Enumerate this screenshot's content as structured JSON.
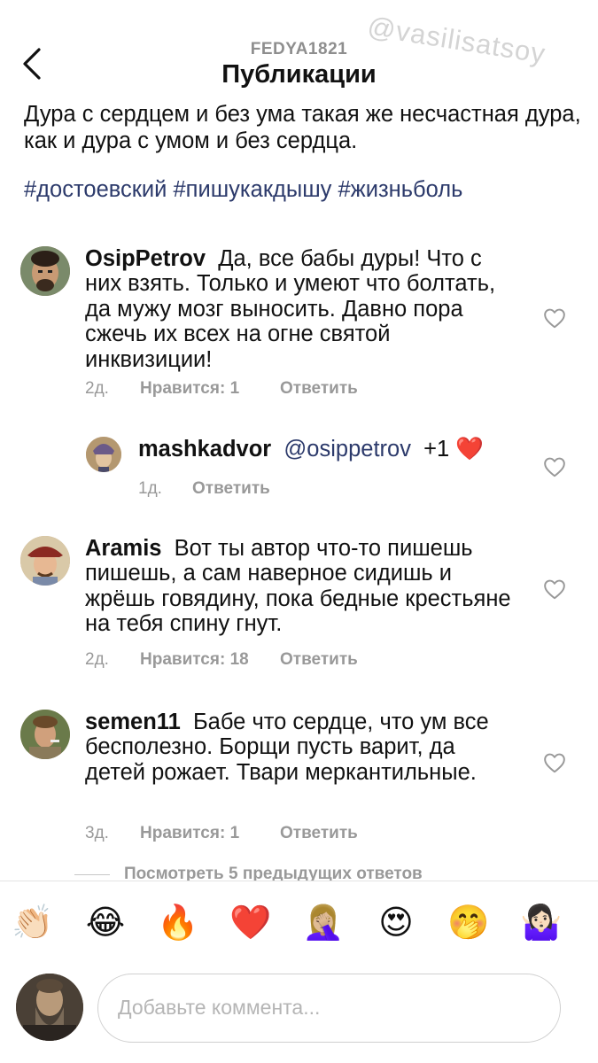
{
  "header": {
    "username": "FEDYA1821",
    "title": "Публикации",
    "watermark": "@vasilisatsoy"
  },
  "post": {
    "caption": "Дура с сердцем и без ума такая же несчастная дура, как и дура с умом и без сердца.",
    "hashtags": "#достоевский #пишукакдышу #жизньболь"
  },
  "comments": [
    {
      "username": "OsipPetrov",
      "text": "Да, все бабы дуры! Что с них взять. Только и умеют что болтать, да мужу мозг выносить. Давно пора сжечь их всех на огне святой инквизиции!",
      "time": "2д.",
      "likes": "Нравится: 1",
      "reply": "Ответить"
    },
    {
      "username": "mashkadvor",
      "mention": "@osippetrov",
      "text": "+1",
      "emoji": "❤️",
      "time": "1д.",
      "reply": "Ответить"
    },
    {
      "username": "Aramis",
      "text": "Вот ты автор что-то пишешь пишешь, а сам наверное сидишь и жрёшь говядину, пока бедные крестьяне на тебя спину гнут.",
      "time": "2д.",
      "likes": "Нравится: 18",
      "reply": "Ответить"
    },
    {
      "username": "semen11",
      "text": "Бабе что сердце, что ум все бесполезно. Борщи пусть варит, да детей рожает. Твари меркантильные.",
      "time": "3д.",
      "likes": "Нравится: 1",
      "reply": "Ответить"
    }
  ],
  "view_replies": "Посмотреть 5 предыдущих ответов",
  "composer": {
    "emojis": [
      "👏🏻",
      "😂",
      "🔥",
      "❤️",
      "🤦🏼‍♀️",
      "😍",
      "🤭",
      "🤷🏻‍♀️"
    ],
    "placeholder": "Добавьте коммента..."
  },
  "colors": {
    "hashtag": "#2c3a6b",
    "meta": "#999999",
    "heart": "#ed4956"
  }
}
